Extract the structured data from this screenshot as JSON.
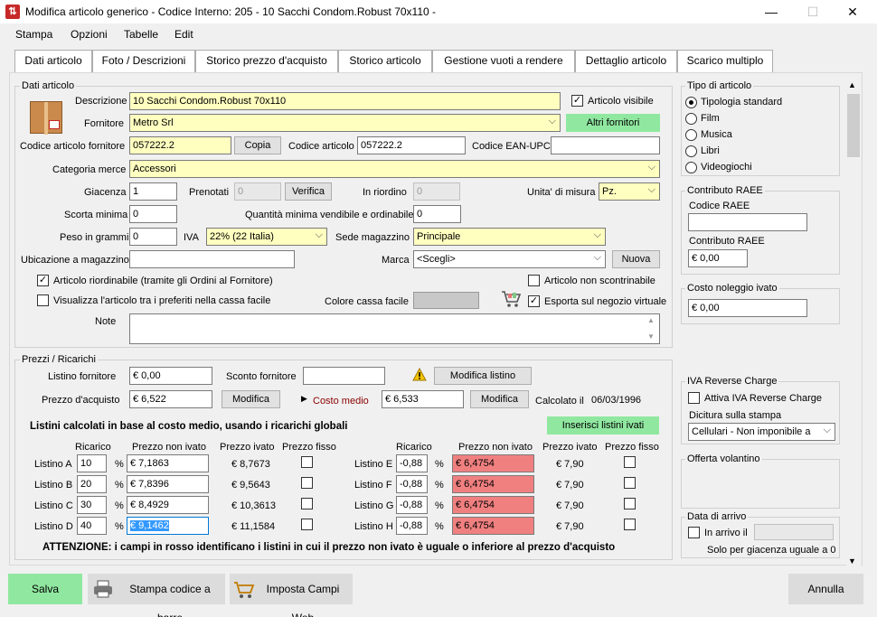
{
  "window": {
    "title": "Modifica articolo generico - Codice Interno: 205 - 10 Sacchi Condom.Robust 70x110 -",
    "minimize": "—",
    "maximize": "☐",
    "close": "✕"
  },
  "menu": [
    "Stampa",
    "Opzioni",
    "Tabelle",
    "Edit"
  ],
  "tabs": [
    "Dati articolo",
    "Foto / Descrizioni",
    "Storico prezzo d'acquisto",
    "Storico articolo",
    "Gestione vuoti a rendere",
    "Dettaglio articolo",
    "Scarico multiplo"
  ],
  "dati": {
    "group_title": "Dati articolo",
    "descrizione_label": "Descrizione",
    "descrizione": "10 Sacchi Condom.Robust 70x110",
    "articolo_visibile_label": "Articolo visibile",
    "articolo_visibile": true,
    "fornitore_label": "Fornitore",
    "fornitore": "Metro Srl",
    "altri_fornitori": "Altri fornitori",
    "cod_fornitore_label": "Codice articolo fornitore",
    "cod_fornitore": "057222.2",
    "copia": "Copia",
    "cod_articolo_label": "Codice articolo",
    "cod_articolo": "057222.2",
    "ean_label": "Codice EAN-UPC",
    "ean": "",
    "categoria_label": "Categoria merce",
    "categoria": "Accessori",
    "giacenza_label": "Giacenza",
    "giacenza": "1",
    "prenotati_label": "Prenotati",
    "prenotati": "0",
    "verifica": "Verifica",
    "riordino_label": "In riordino",
    "riordino": "0",
    "unita_label": "Unita' di misura",
    "unita": "Pz.",
    "scorta_label": "Scorta minima",
    "scorta": "0",
    "qta_min_label": "Quantità minima vendibile e ordinabile",
    "qta_min": "0",
    "peso_label": "Peso in grammi",
    "peso": "0",
    "iva_label": "IVA",
    "iva": "22% (22 Italia)",
    "sede_label": "Sede magazzino",
    "sede": "Principale",
    "ubicazione_label": "Ubicazione a magazzino",
    "ubicazione": "",
    "marca_label": "Marca",
    "marca": "<Scegli>",
    "nuova": "Nuova",
    "riordinabile_label": "Articolo riordinabile (tramite gli Ordini al Fornitore)",
    "non_scontrinabile_label": "Articolo non scontrinabile",
    "preferiti_label": "Visualizza l'articolo tra i preferiti nella cassa facile",
    "colore_label": "Colore cassa facile",
    "esporta_label": "Esporta sul negozio virtuale",
    "note_label": "Note"
  },
  "tipo": {
    "title": "Tipo di articolo",
    "options": [
      "Tipologia standard",
      "Film",
      "Musica",
      "Libri",
      "Videogiochi"
    ]
  },
  "raee": {
    "title": "Contributo RAEE",
    "codice_label": "Codice RAEE",
    "codice": "",
    "contributo_label": "Contributo RAEE",
    "contributo": "€ 0,00"
  },
  "noleggio": {
    "title": "Costo noleggio ivato",
    "value": "€ 0,00"
  },
  "reverse": {
    "title": "IVA Reverse Charge",
    "attiva_label": "Attiva IVA Reverse Charge",
    "dicitura_label": "Dicitura sulla stampa",
    "dicitura": "Cellulari - Non imponibile a"
  },
  "offerta": {
    "title": "Offerta volantino"
  },
  "arrivo": {
    "title": "Data di arrivo",
    "in_arrivo_label": "In arrivo il",
    "note": "Solo per giacenza uguale a 0"
  },
  "prezzi": {
    "group_title": "Prezzi / Ricarichi",
    "listino_fornitore_label": "Listino fornitore",
    "listino_fornitore": "€ 0,00",
    "sconto_label": "Sconto fornitore",
    "sconto": "",
    "modifica_listino": "Modifica listino",
    "prezzo_acquisto_label": "Prezzo d'acquisto",
    "prezzo_acquisto": "€ 6,522",
    "modifica": "Modifica",
    "costo_medio_label": "Costo medio",
    "costo_medio": "€ 6,533",
    "modifica2": "Modifica",
    "calcolato_label": "Calcolato il",
    "calcolato": "06/03/1996",
    "listini_title": "Listini calcolati in base al costo medio, usando i ricarichi globali",
    "inserisci": "Inserisci listini ivati",
    "headers": [
      "Ricarico",
      "Prezzo non ivato",
      "Prezzo ivato",
      "Prezzo fisso"
    ],
    "percent": "%",
    "left": [
      {
        "name": "Listino A",
        "ricarico": "10",
        "non_ivato": "€ 7,1863",
        "ivato": "€ 8,7673"
      },
      {
        "name": "Listino B",
        "ricarico": "20",
        "non_ivato": "€ 7,8396",
        "ivato": "€ 9,5643"
      },
      {
        "name": "Listino C",
        "ricarico": "30",
        "non_ivato": "€ 8,4929",
        "ivato": "€ 10,3613"
      },
      {
        "name": "Listino D",
        "ricarico": "40",
        "non_ivato": "€ 9,1462",
        "ivato": "€ 11,1584"
      }
    ],
    "right": [
      {
        "name": "Listino E",
        "ricarico": "-0,88",
        "non_ivato": "€ 6,4754",
        "ivato": "€ 7,90"
      },
      {
        "name": "Listino F",
        "ricarico": "-0,88",
        "non_ivato": "€ 6,4754",
        "ivato": "€ 7,90"
      },
      {
        "name": "Listino G",
        "ricarico": "-0,88",
        "non_ivato": "€ 6,4754",
        "ivato": "€ 7,90"
      },
      {
        "name": "Listino H",
        "ricarico": "-0,88",
        "non_ivato": "€ 6,4754",
        "ivato": "€ 7,90"
      }
    ],
    "attenzione": "ATTENZIONE: i campi in rosso identificano i listini in cui il prezzo non ivato è uguale o inferiore al prezzo d'acquisto"
  },
  "bottom": {
    "salva": "Salva",
    "stampa": "Stampa codice a barre",
    "imposta": "Imposta Campi Web",
    "annulla": "Annulla"
  },
  "colors": {
    "yellow_field": "#ffffc0",
    "red_field": "#f08080",
    "green_button": "#90e8a0"
  }
}
